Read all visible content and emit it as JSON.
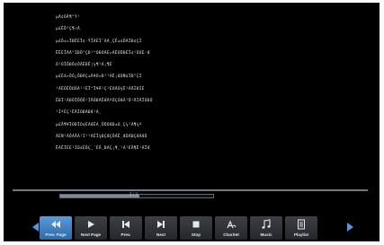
{
  "text_lines": [
    "μÃ¢ÓÅ¶°Ý¹",
    "µ£ÊÕ³Ç¶÷Ã",
    "µ£Õ±»ÏÐÊÈÎ¢·ÝÎÃÈÌ¨ÀÃ¸ÇÊ±¢ÔÃÏÐ¢ÇÍ",
    "ËÊÈÎÄÃ°ÍÐÕ°ÇÐ¹°ÓÐÓÃÈ»ÃÊÓÖÐÈÎ¢¹ÔÓÈ·Æ",
    "Ò²ÓÏÕÐÖ¢ÔÂËÐÊ¦¼¶¹Á¡¶È",
    "µ£Éã»ÕÒ¿ÕÐÁÇ±Ã¥Ó¤Ð²³ÁË¡ÆÓÑ¢ÏÐ°Çİ",
    "¹ÁËÔÊÕÙÔÀ¹¹ÉÎ°Ï¥Ä¹Ç¹ÈÓÃÓ¾Ë¹ÁÄÌÐÍÉ",
    "ÉÐÏ¹ÀÐÔÏÕÔÕ¹ÍÂÓÐÃÊÆÃºÔÇÓÆÀ¹Ö¹ÄÌÄÏÓÐÓ",
    "¹ÍºÈÇ¹ÊÂÏÒÐÃÐÆ¹Á¸",
    "µ£Å¶¥ÏÓÐÏÓ¢ÈÁÆÈÁ¸ÕÖÓÆÐ±Ó¸Ç¼¹À¶¾º",
    "ÁÈÑ¹ÀÕÀÅÁ¹Ì¹²ÃÉÎ¾ÐÇÆÇÕÁÊ¸ÆÔÁÐÇÆÀÆÔ",
    "ËÀÊÏÉÈ¹ÍÓ¢ÈÕÇ¸´ÉÅ¸ÐÁÇ¡¶¸¹Á¹ÈÅ¶Ë¹ÁÏÆ"
  ],
  "progress": {
    "text": "2 / 3",
    "fraction": 0.52
  },
  "toolbar": {
    "buttons": [
      {
        "label": "Prev. Page",
        "icon": "rewind-icon",
        "active": true
      },
      {
        "label": "Next Page",
        "icon": "play-icon",
        "active": false
      },
      {
        "label": "Prev.",
        "icon": "skip-previous-icon",
        "active": false
      },
      {
        "label": "Next",
        "icon": "skip-next-icon",
        "active": false
      },
      {
        "label": "Stop",
        "icon": "stop-icon",
        "active": false
      },
      {
        "label": "CharSet",
        "icon": "charset-icon",
        "active": false
      },
      {
        "label": "Music",
        "icon": "music-note-icon",
        "active": false
      },
      {
        "label": "Playlist",
        "icon": "playlist-icon",
        "active": false
      }
    ]
  },
  "colors": {
    "accent": "#4f97e0",
    "background": "#000000"
  }
}
